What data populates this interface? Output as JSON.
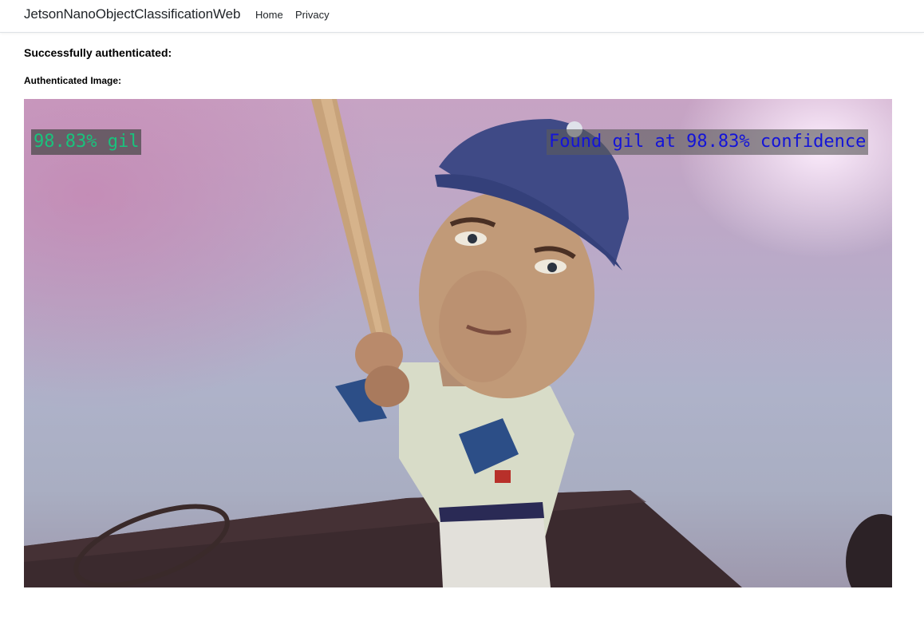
{
  "navbar": {
    "brand": "JetsonNanoObjectClassificationWeb",
    "links": [
      {
        "label": "Home"
      },
      {
        "label": "Privacy"
      }
    ]
  },
  "main": {
    "status_heading": "Successfully authenticated:",
    "image_heading": "Authenticated Image:",
    "image": {
      "overlay_left": "98.83% gil",
      "overlay_right": "Found gil at 98.83% confidence"
    }
  }
}
